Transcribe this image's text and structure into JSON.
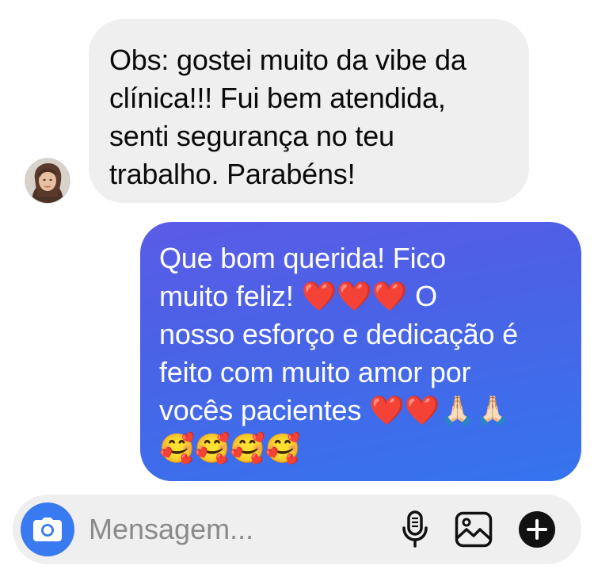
{
  "thread": {
    "incoming": {
      "lines": [
        "Obs: gostei muito da vibe da",
        "clínica!!! Fui bem atendida,",
        "senti segurança no teu",
        "trabalho. Parabéns!"
      ]
    },
    "outgoing": {
      "lines": [
        "Que bom querida! Fico",
        "muito feliz! ❤️❤️❤️ O",
        "nosso esforço e dedicação é",
        "feito com muito amor por",
        "vocês pacientes ❤️❤️🙏🏻🙏🏻",
        "🥰🥰🥰🥰"
      ]
    }
  },
  "composer": {
    "placeholder": "Mensagem...",
    "icons": {
      "camera": "camera-icon",
      "mic": "microphone-icon",
      "gallery": "gallery-icon",
      "add": "plus-icon"
    }
  },
  "colors": {
    "incoming_bubble": "#efefef",
    "outgoing_gradient_start": "#5a5be6",
    "outgoing_gradient_end": "#3574ee",
    "camera_button": "#3a7af0"
  }
}
